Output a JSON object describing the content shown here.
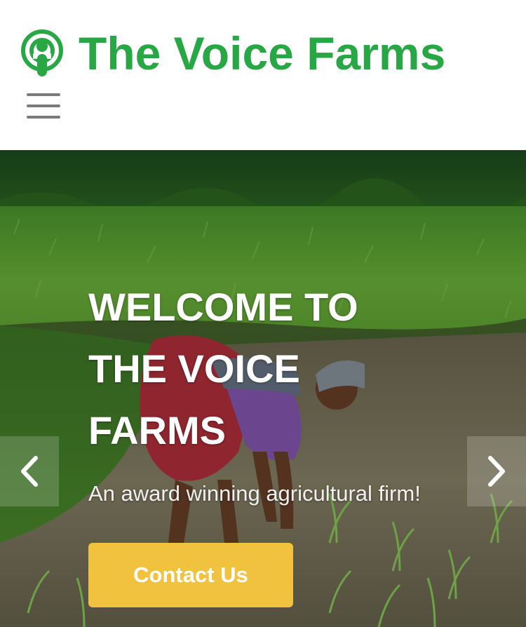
{
  "header": {
    "brand": "The Voice Farms",
    "logo_icon": "podcast-icon",
    "menu_icon": "hamburger-menu-icon",
    "brand_color": "#28a745"
  },
  "hero": {
    "title": "WELCOME TO THE VOICE FARMS",
    "subtitle": "An award winning agricultural firm!",
    "cta_label": "Contact Us",
    "cta_color": "#f0c23e",
    "prev_icon": "chevron-left-icon",
    "next_icon": "chevron-right-icon"
  }
}
